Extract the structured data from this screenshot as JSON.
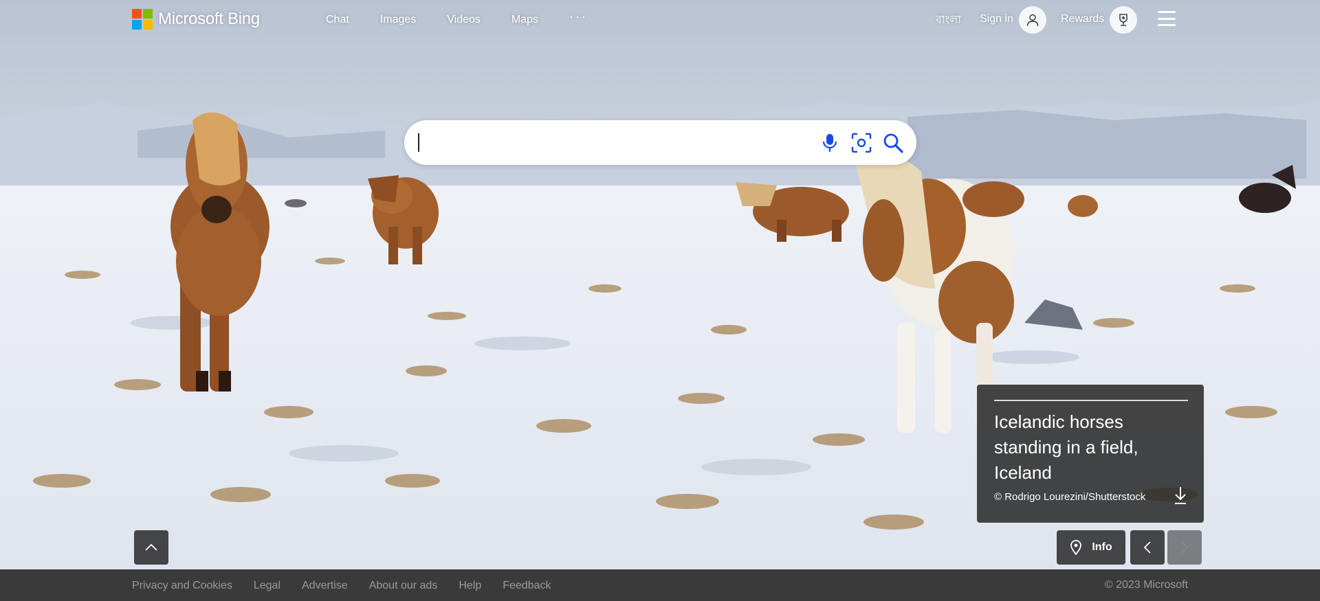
{
  "brand": {
    "name": "Microsoft Bing",
    "logo_colors": [
      "#f25022",
      "#7fba00",
      "#00a4ef",
      "#ffb900"
    ]
  },
  "nav": {
    "items": [
      {
        "label": "Chat"
      },
      {
        "label": "Images"
      },
      {
        "label": "Videos"
      },
      {
        "label": "Maps"
      }
    ],
    "more_label": "···"
  },
  "header_right": {
    "language": "বাংলা",
    "signin": "Sign in",
    "rewards": "Rewards"
  },
  "search": {
    "value": "",
    "placeholder": "",
    "icons": [
      "microphone-icon",
      "visual-search-icon",
      "search-icon"
    ],
    "accent_color": "#174ae4"
  },
  "image_caption": {
    "title": "Icelandic horses standing in a field, Iceland",
    "credit": "© Rodrigo Lourezini/Shutterstock"
  },
  "controls": {
    "info_label": "Info"
  },
  "footer": {
    "links": [
      "Privacy and Cookies",
      "Legal",
      "Advertise",
      "About our ads",
      "Help",
      "Feedback"
    ],
    "copyright": "© 2023 Microsoft"
  }
}
